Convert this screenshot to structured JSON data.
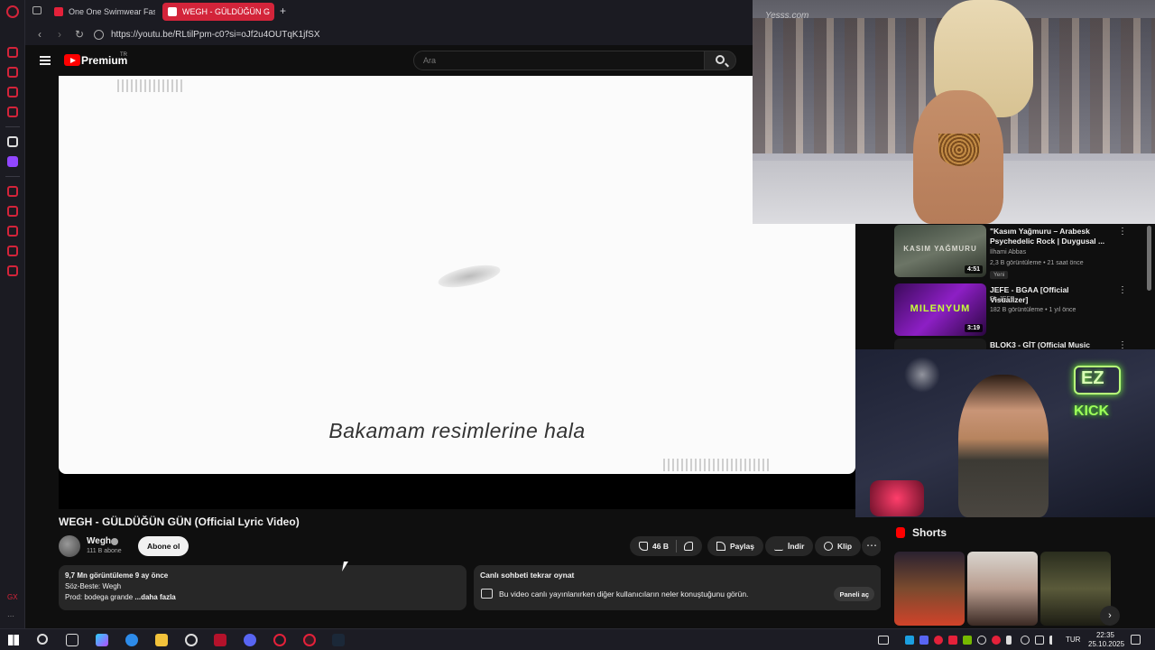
{
  "browser": {
    "tabs": [
      {
        "label": "One One Swimwear Fash"
      },
      {
        "label": "WEGH - GÜLDÜĞÜN G",
        "active": true
      }
    ],
    "new_tab": "+",
    "url": "https://youtu.be/RLtilPpm-c0?si=oJf2u4OUTqK1jfSX"
  },
  "youtube": {
    "brand": "Premium",
    "region": "TR",
    "search_placeholder": "Ara"
  },
  "video": {
    "lyric": "Bakamam resimlerine hala",
    "title": "WEGH - GÜLDÜĞÜN GÜN (Official Lyric Video)",
    "channel": "Wegh",
    "subscribers": "111 B abone",
    "subscribe_label": "Abone ol",
    "likes": "46 B",
    "share_label": "Paylaş",
    "download_label": "İndir",
    "clip_label": "Klip",
    "more_label": "⋯"
  },
  "description": {
    "views_date": "9,7 Mn görüntüleme  9 ay önce",
    "line2": "Söz-Beste: Wegh",
    "line3": "Prod: bodega grande",
    "more": "...daha fazla"
  },
  "chat_replay": {
    "title": "Canlı sohbeti tekrar oynat",
    "text": "Bu video canlı yayınlanırken diğer kullanıcıların neler konuştuğunu görün.",
    "button": "Paneli aç"
  },
  "recommendations": [
    {
      "title": "\"Kasım Yağmuru – Arabesk Psychedelic Rock | Duygusal ...",
      "channel": "İlhami Abbas",
      "meta": "2,3 B görüntüleme • 21 saat önce",
      "badge": "Yeni",
      "duration": "4:51",
      "thumb_text": "KASIM YAĞMURU"
    },
    {
      "title": "JEFE - BGAA [Official Visualizer]",
      "channel": "EL JEFE",
      "meta": "182 B görüntüleme • 1 yıl önce",
      "duration": "3:19",
      "thumb_text": "MILENYUM"
    },
    {
      "title": "BLOK3 - GİT (Official Music",
      "channel": "",
      "meta": ""
    }
  ],
  "shorts": {
    "label": "Shorts"
  },
  "overlays": {
    "runway_watermark": "Yesss.com",
    "cam_neon_top": "EZ",
    "cam_neon_bottom": "KICK"
  },
  "taskbar": {
    "lang": "TUR",
    "time": "22:35",
    "date": "25.10.2025"
  },
  "colors": {
    "accent": "#d3243a",
    "yt_red": "#ff0000",
    "bg": "#0f0f0f",
    "surface": "#272727"
  }
}
